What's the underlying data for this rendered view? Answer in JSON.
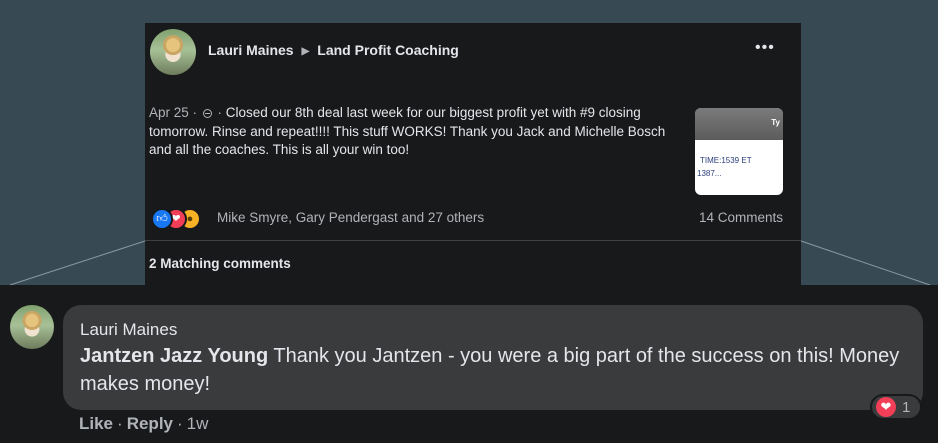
{
  "post": {
    "author": "Lauri Maines",
    "group": "Land Profit Coaching",
    "date": "Apr 25",
    "text": "Closed our 8th deal last week for our biggest profit yet with #9 closing tomorrow. Rinse and repeat!!!! This stuff WORKS! Thank you Jack and Michelle Bosch and all the coaches. This is all your win too!",
    "reactions_text": "Mike Smyre, Gary Pendergast and 27 others",
    "comments_count": "14 Comments",
    "matching_comments": "2 Matching comments",
    "thumbnail": {
      "tag": "Ty",
      "line1": "TIME:1539 ET",
      "line2": "1387..."
    }
  },
  "comment": {
    "author": "Lauri Maines",
    "mention": "Jantzen Jazz Young",
    "text": "Thank you Jantzen - you were a big part of the success on this! Money makes money!",
    "reaction_count": "1",
    "actions": {
      "like": "Like",
      "reply": "Reply",
      "time": "1w"
    }
  },
  "icons": [
    "globe-icon",
    "more-icon",
    "like-reaction-icon",
    "love-reaction-icon",
    "wow-reaction-icon",
    "heart-icon",
    "caret-right-icon"
  ],
  "colors": {
    "background": "#374952",
    "card": "#18191a",
    "bubble": "#3a3b3c",
    "like_blue": "#1877f2",
    "love_red": "#f33e58"
  }
}
